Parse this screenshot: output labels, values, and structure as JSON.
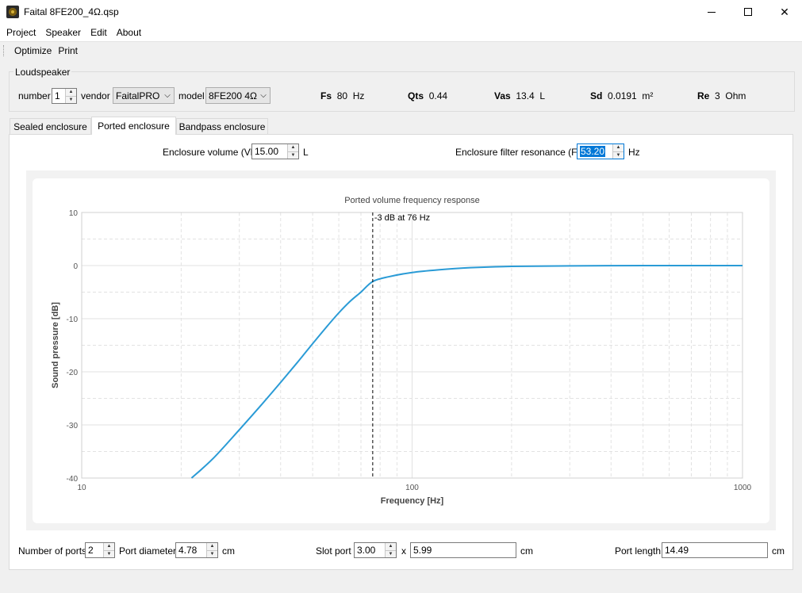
{
  "window": {
    "title": "Faital 8FE200_4Ω.qsp",
    "icon": "speaker-app-icon"
  },
  "menu": [
    "Project",
    "Speaker",
    "Edit",
    "About"
  ],
  "toolbar": [
    "Optimize",
    "Print"
  ],
  "loudspeaker": {
    "group_title": "Loudspeaker",
    "number_label": "number",
    "number_value": "1",
    "vendor_label": "vendor",
    "vendor_value": "FaitalPRO",
    "model_label": "model",
    "model_value": "8FE200 4Ω",
    "params": [
      {
        "key": "Fs",
        "value": "80",
        "unit": "Hz"
      },
      {
        "key": "Qts",
        "value": "0.44",
        "unit": ""
      },
      {
        "key": "Vas",
        "value": "13.4",
        "unit": "L"
      },
      {
        "key": "Sd",
        "value": "0.0191",
        "unit": "m²"
      },
      {
        "key": "Re",
        "value": "3",
        "unit": "Ohm"
      }
    ]
  },
  "tabs": [
    "Sealed enclosure",
    "Ported enclosure",
    "Bandpass enclosure"
  ],
  "active_tab": 1,
  "enclosure": {
    "volume_label": "Enclosure volume (Vb)",
    "volume_value": "15.00",
    "volume_unit": "L",
    "fb_label": "Enclosure filter resonance (Fb)",
    "fb_value": "53.20",
    "fb_unit": "Hz"
  },
  "ports": {
    "num_label": "Number of ports",
    "num_value": "2",
    "diameter_label": "Port diameter",
    "diameter_value": "4.78",
    "diameter_unit": "cm",
    "slot_label": "Slot port",
    "slot_value": "3.00",
    "slot_x": "x",
    "slot_width": "5.99",
    "slot_unit": "cm",
    "length_label": "Port length",
    "length_value": "14.49",
    "length_unit": "cm"
  },
  "colors": {
    "curve": "#2a9bd6",
    "selection": "#0078d7"
  },
  "chart_data": {
    "type": "line",
    "title": "Ported volume frequency response",
    "xlabel": "Frequency [Hz]",
    "ylabel": "Sound pressure [dB]",
    "x_scale": "log",
    "xlim": [
      10,
      1000
    ],
    "ylim": [
      -40,
      10
    ],
    "x_ticks": [
      "10",
      "100",
      "1000"
    ],
    "y_ticks": [
      "10",
      "0",
      "-10",
      "-20",
      "-30",
      "-40"
    ],
    "grid": true,
    "annotation": {
      "x": 76,
      "text": "-3 dB at 76 Hz",
      "style": "dashed-vertical"
    },
    "series": [
      {
        "x": [
          21.5,
          25,
          30,
          35,
          40,
          45,
          50,
          55,
          60,
          65,
          70,
          76,
          85,
          100,
          120,
          150,
          200,
          300,
          500,
          1000
        ],
        "y": [
          -40,
          -36.3,
          -30.9,
          -26.2,
          -22.0,
          -18.2,
          -14.7,
          -11.6,
          -8.9,
          -6.7,
          -5.0,
          -3.0,
          -2.1,
          -1.3,
          -0.8,
          -0.4,
          -0.15,
          -0.05,
          0,
          0
        ]
      }
    ]
  }
}
